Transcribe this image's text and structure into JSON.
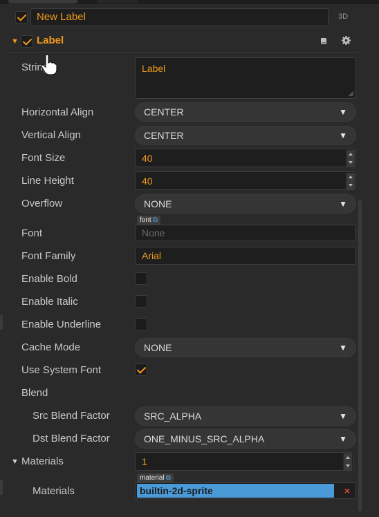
{
  "node": {
    "name": "New Label",
    "mode_tag": "3D",
    "enabled": true
  },
  "component": {
    "title": "Label",
    "enabled": true,
    "book_icon": "book-icon",
    "settings_icon": "gear-icon"
  },
  "properties": {
    "string": {
      "label": "String",
      "value": "Label"
    },
    "horizontal_align": {
      "label": "Horizontal Align",
      "value": "CENTER"
    },
    "vertical_align": {
      "label": "Vertical Align",
      "value": "CENTER"
    },
    "font_size": {
      "label": "Font Size",
      "value": "40"
    },
    "line_height": {
      "label": "Line Height",
      "value": "40"
    },
    "overflow": {
      "label": "Overflow",
      "value": "NONE"
    },
    "font": {
      "label": "Font",
      "tag": "font",
      "placeholder": "None"
    },
    "font_family": {
      "label": "Font Family",
      "value": "Arial"
    },
    "enable_bold": {
      "label": "Enable Bold",
      "checked": false
    },
    "enable_italic": {
      "label": "Enable Italic",
      "checked": false
    },
    "enable_underline": {
      "label": "Enable Underline",
      "checked": false
    },
    "cache_mode": {
      "label": "Cache Mode",
      "value": "NONE"
    },
    "use_system_font": {
      "label": "Use System Font",
      "checked": true
    },
    "blend": {
      "label": "Blend"
    },
    "src_blend_factor": {
      "label": "Src Blend Factor",
      "value": "SRC_ALPHA"
    },
    "dst_blend_factor": {
      "label": "Dst Blend Factor",
      "value": "ONE_MINUS_SRC_ALPHA"
    },
    "materials_count": {
      "label": "Materials",
      "value": "1"
    },
    "materials": {
      "label": "Materials",
      "tag": "material",
      "value": "builtin-2d-sprite",
      "remove_glyph": "×"
    }
  },
  "colors": {
    "accent": "#f29a1a",
    "selected_asset": "#4a9ad8"
  },
  "glyphs": {
    "dropdown_arrow": "▼",
    "expand_caret": "▼",
    "link": "⧉"
  }
}
